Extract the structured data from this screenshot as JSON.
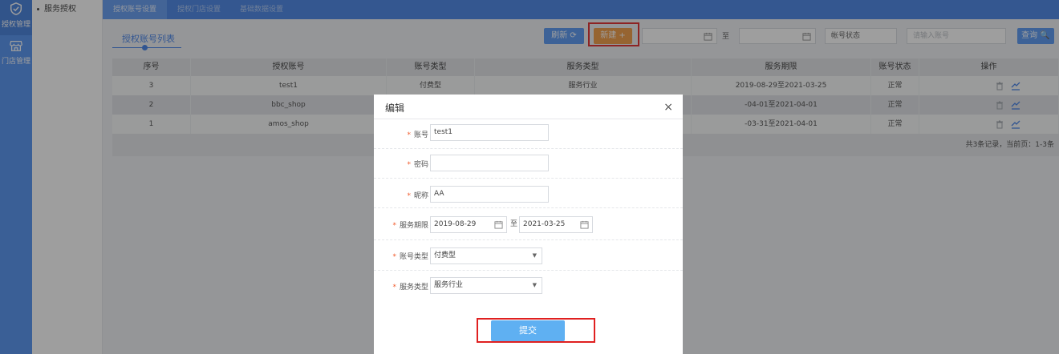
{
  "rail": [
    {
      "label": "授权管理",
      "icon": "shield-check-icon"
    },
    {
      "label": "门店管理",
      "icon": "store-icon"
    }
  ],
  "sidebar": {
    "items": [
      {
        "label": "服务授权"
      }
    ]
  },
  "tabs": [
    {
      "label": "授权账号设置"
    },
    {
      "label": "授权门店设置"
    },
    {
      "label": "基础数据设置"
    }
  ],
  "section_title": "授权账号列表",
  "toolbar": {
    "refresh_label": "刷新 ⟳",
    "new_label": "新建 +",
    "to_label": "至",
    "status_placeholder": "帐号状态",
    "account_placeholder": "请输入账号",
    "query_label": "查询 🔍"
  },
  "table": {
    "headers": [
      "序号",
      "授权账号",
      "账号类型",
      "服务类型",
      "服务期限",
      "账号状态",
      "操作"
    ],
    "rows": [
      {
        "no": "3",
        "account": "test1",
        "acct_type": "付费型",
        "svc_type": "服务行业",
        "period": "2019-08-29至2021-03-25",
        "status": "正常"
      },
      {
        "no": "2",
        "account": "bbc_shop",
        "acct_type": "",
        "svc_type": "",
        "period": "-04-01至2021-04-01",
        "status": "正常"
      },
      {
        "no": "1",
        "account": "amos_shop",
        "acct_type": "",
        "svc_type": "",
        "period": "-03-31至2021-04-01",
        "status": "正常"
      }
    ],
    "footer": "共3条记录，当前页：1-3条"
  },
  "modal": {
    "title": "编辑",
    "close": "×",
    "fields": {
      "account": {
        "label": "账号",
        "value": "test1"
      },
      "password": {
        "label": "密码",
        "value": ""
      },
      "nickname": {
        "label": "昵称",
        "value": "AA"
      },
      "period": {
        "label": "服务期限",
        "start": "2019-08-29",
        "to": "至",
        "end": "2021-03-25"
      },
      "acct_type": {
        "label": "账号类型",
        "value": "付费型"
      },
      "svc_type": {
        "label": "服务类型",
        "value": "服务行业"
      }
    },
    "required_mark": "*",
    "dropdown_arrow": "▼",
    "submit_label": "提交"
  },
  "colors": {
    "primary": "#3f7fe6",
    "accent_orange": "#f0953a",
    "highlight": "#e02020",
    "required": "#f15a2b"
  }
}
